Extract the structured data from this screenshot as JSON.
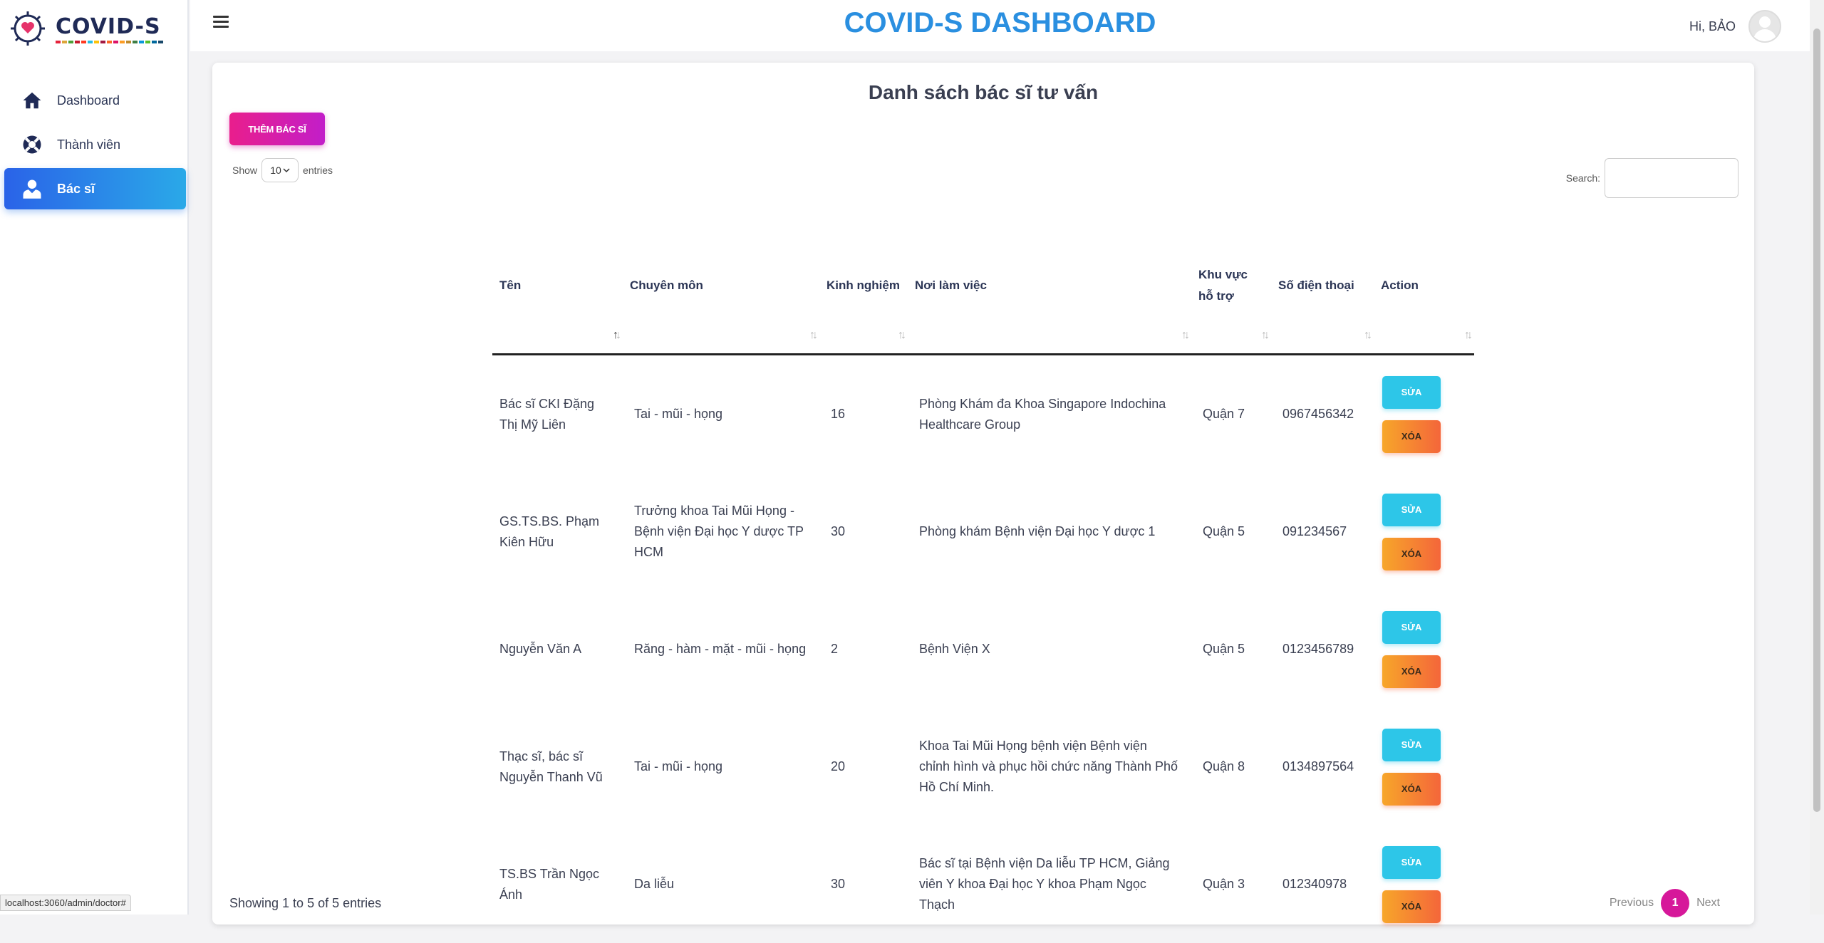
{
  "brand": {
    "name": "COVID-S"
  },
  "sidebar": {
    "items": [
      {
        "label": "Dashboard",
        "icon": "home-icon"
      },
      {
        "label": "Thành viên",
        "icon": "lifebuoy-icon"
      },
      {
        "label": "Bác sĩ",
        "icon": "doctor-icon",
        "active": true
      }
    ]
  },
  "header": {
    "title": "COVID-S DASHBOARD",
    "greeting": "Hi, BẢO"
  },
  "page": {
    "title": "Danh sách bác sĩ tư vấn",
    "add_button": "THÊM BÁC SĨ",
    "show_label": "Show",
    "entries_value": "10",
    "entries_label": "entries",
    "search_label": "Search:",
    "search_value": "",
    "info": "Showing 1 to 5 of 5 entries",
    "pagination": {
      "previous": "Previous",
      "current": "1",
      "next": "Next"
    }
  },
  "table": {
    "columns": [
      "Tên",
      "Chuyên môn",
      "Kinh nghiệm",
      "Nơi làm việc",
      "Khu vực hỗ trợ",
      "Số điện thoại",
      "Action"
    ],
    "rows": [
      {
        "name": "Bác sĩ CKI Đặng Thị Mỹ Liên",
        "specialty": "Tai - mũi - họng",
        "experience": "16",
        "workplace": "Phòng Khám đa Khoa Singapore Indochina Healthcare Group",
        "area": "Quận 7",
        "phone": "0967456342"
      },
      {
        "name": "GS.TS.BS. Phạm Kiên Hữu",
        "specialty": "Trưởng khoa Tai Mũi Họng - Bệnh viện Đại học Y dược TP HCM",
        "experience": "30",
        "workplace": "Phòng khám Bệnh viện Đại học Y dược 1",
        "area": "Quận 5",
        "phone": "091234567"
      },
      {
        "name": "Nguyễn Văn A",
        "specialty": "Răng - hàm - mặt - mũi - họng",
        "experience": "2",
        "workplace": "Bệnh Viện X",
        "area": "Quận 5",
        "phone": "0123456789"
      },
      {
        "name": "Thạc sĩ, bác sĩ Nguyễn Thanh Vũ",
        "specialty": "Tai - mũi - họng",
        "experience": "20",
        "workplace": "Khoa Tai Mũi Họng bệnh viện Bệnh viện chỉnh hình và phục hồi chức năng Thành Phố Hồ Chí Minh.",
        "area": "Quận 8",
        "phone": "0134897564"
      },
      {
        "name": "TS.BS Trần Ngọc Ánh",
        "specialty": "Da liễu",
        "experience": "30",
        "workplace": "Bác sĩ tại Bệnh viện Da liễu TP HCM, Giảng viên Y khoa Đại học Y khoa Phạm Ngọc Thạch",
        "area": "Quận 3",
        "phone": "012340978"
      }
    ],
    "edit_label": "SỬA",
    "delete_label": "XÓA"
  },
  "status_bar": {
    "url": "localhost:3060/admin/doctor#"
  },
  "colors": {
    "primary": "#2a8fe0",
    "accent": "#d6189a",
    "edit": "#2dc6e8",
    "delete": "#f4663a"
  }
}
